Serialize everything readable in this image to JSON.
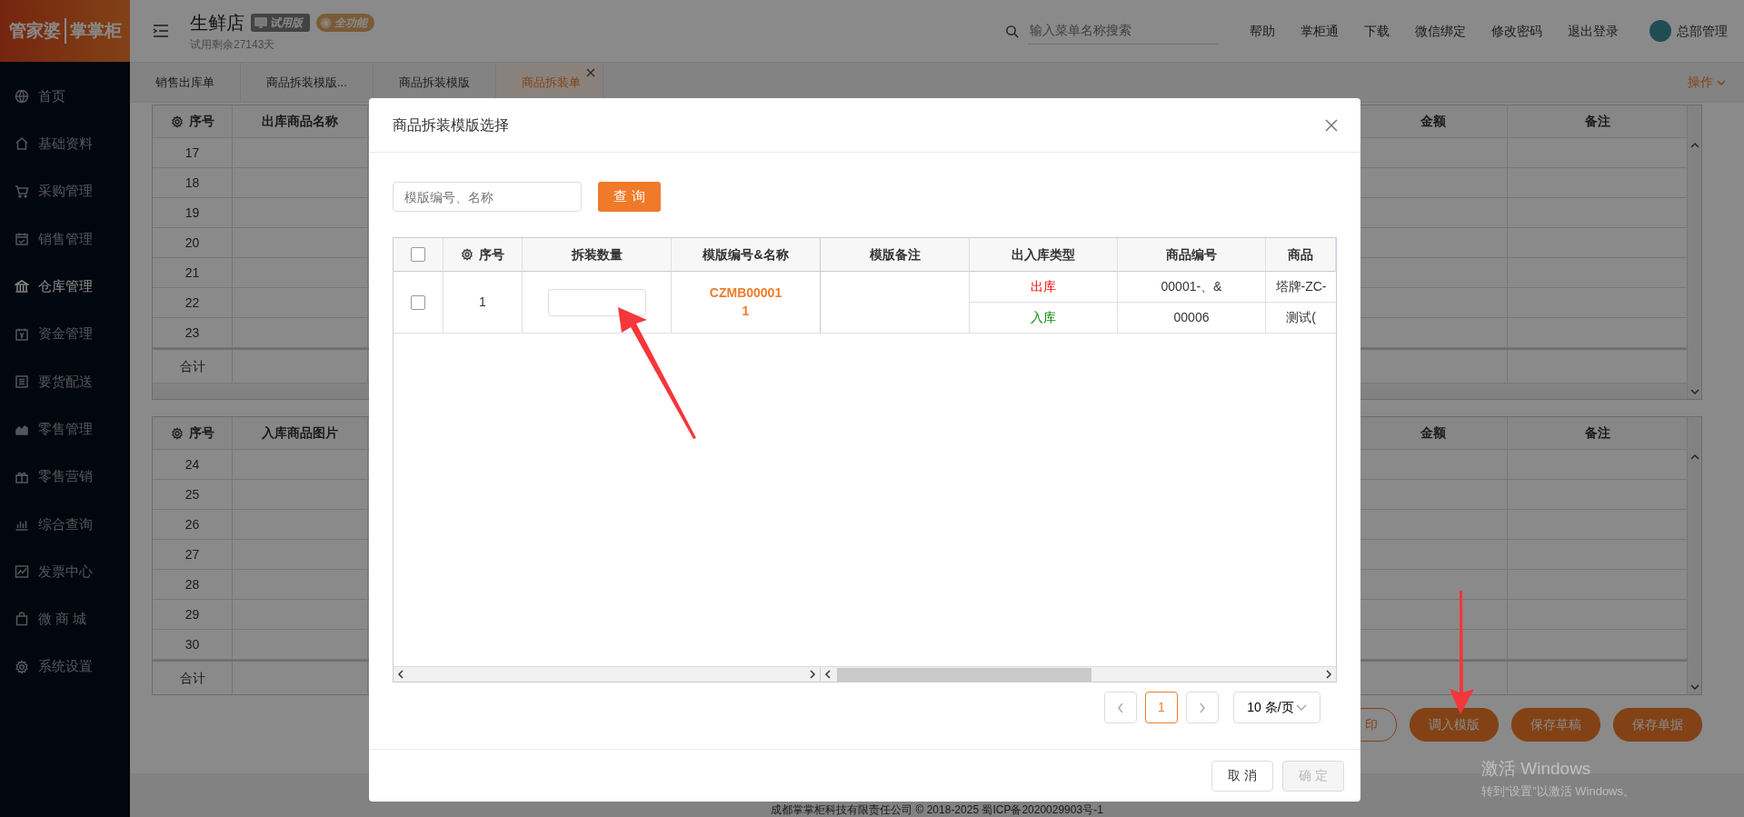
{
  "sidebar": {
    "logo": [
      "管家婆",
      "掌掌柜"
    ],
    "items": [
      {
        "label": "首页",
        "selected": false
      },
      {
        "label": "基础资料",
        "selected": false
      },
      {
        "label": "采购管理",
        "selected": false
      },
      {
        "label": "销售管理",
        "selected": false
      },
      {
        "label": "仓库管理",
        "selected": true
      },
      {
        "label": "资金管理",
        "selected": false
      },
      {
        "label": "要货配送",
        "selected": false
      },
      {
        "label": "零售管理",
        "selected": false
      },
      {
        "label": "零售营销",
        "selected": false
      },
      {
        "label": "综合查询",
        "selected": false
      },
      {
        "label": "发票中心",
        "selected": false
      },
      {
        "label": "微 商 城",
        "selected": false
      },
      {
        "label": "系统设置",
        "selected": false
      }
    ]
  },
  "header": {
    "shop_name": "生鲜店",
    "badges": [
      {
        "label": "试用版",
        "kind": "trial"
      },
      {
        "label": "全功能",
        "kind": "full"
      }
    ],
    "trial_note": "试用剩余27143天",
    "search_placeholder": "输入菜单名称搜索",
    "links": [
      "帮助",
      "掌柜通",
      "下载",
      "微信绑定",
      "修改密码",
      "退出登录"
    ],
    "user": "总部管理"
  },
  "tabs": [
    {
      "label": "销售出库单",
      "selected": false,
      "closable": false
    },
    {
      "label": "商品拆装模版...",
      "selected": false,
      "closable": false
    },
    {
      "label": "商品拆装模版",
      "selected": false,
      "closable": false
    },
    {
      "label": "商品拆装单",
      "selected": true,
      "closable": true
    }
  ],
  "tab_menu": "操作",
  "out_table": {
    "columns": [
      "序号",
      "出库商品名称",
      "金额",
      "备注"
    ],
    "rows": [
      "17",
      "18",
      "19",
      "20",
      "21",
      "22",
      "23"
    ],
    "total_label": "合计"
  },
  "in_table": {
    "columns": [
      "序号",
      "入库商品图片",
      "金额",
      "备注"
    ],
    "rows": [
      "24",
      "25",
      "26",
      "27",
      "28",
      "29",
      "30"
    ],
    "total_label": "合计"
  },
  "actions": [
    {
      "label": "印",
      "kind": "outline"
    },
    {
      "label": "调入模版",
      "kind": "solid"
    },
    {
      "label": "保存草稿",
      "kind": "solid"
    },
    {
      "label": "保存单据",
      "kind": "solid"
    }
  ],
  "footer": "成都掌掌柜科技有限责任公司 © 2018-2025 蜀ICP备2020029903号-1",
  "dialog": {
    "title": "商品拆装模版选择",
    "search_placeholder": "模版编号、名称",
    "query_button": "查 询",
    "header_checked": false,
    "columns": [
      "序号",
      "拆装数量",
      "模版编号&名称",
      "模版备注",
      "出入库类型",
      "商品编号",
      "商品"
    ],
    "rows": [
      {
        "checked": false,
        "index": "1",
        "template_code": "CZMB00001",
        "template_name": "1",
        "items": [
          {
            "kind": "out",
            "direction": "出库",
            "code": "00001-、&",
            "name": "塔牌-ZC-"
          },
          {
            "kind": "in",
            "direction": "入库",
            "code": "00006",
            "name": "测试("
          }
        ]
      }
    ],
    "pages": [
      {
        "label": "1",
        "selected": true
      }
    ],
    "page_size": "10 条/页",
    "buttons": [
      {
        "label": "取 消",
        "disabled": false
      },
      {
        "label": "确 定",
        "disabled": true
      }
    ]
  },
  "os_notice": {
    "title": "激活 Windows",
    "text": "转到“设置”以激活 Windows。"
  }
}
